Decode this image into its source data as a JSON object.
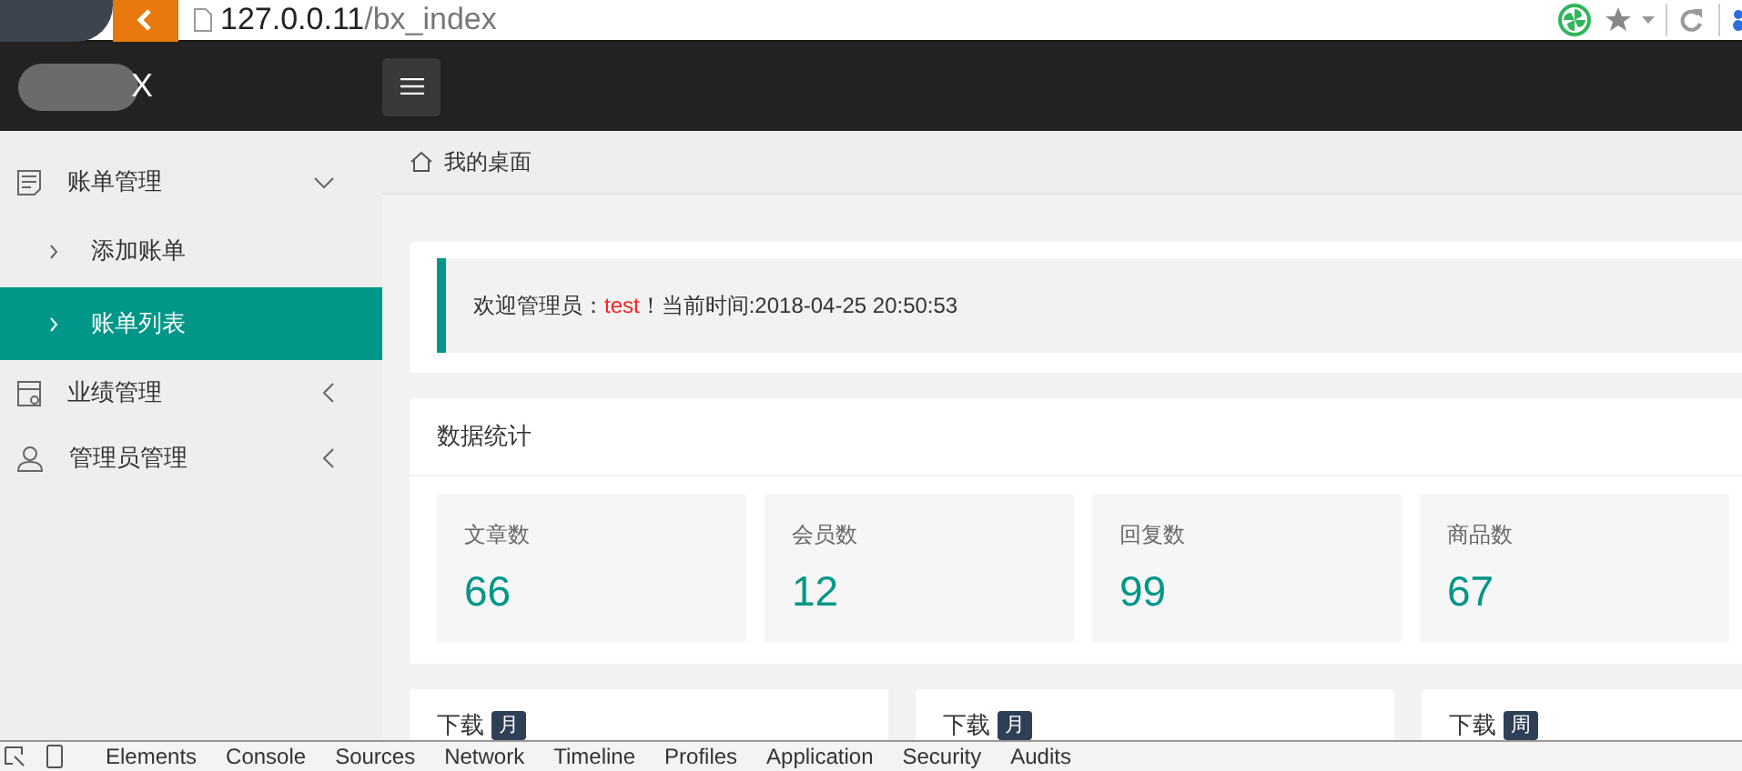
{
  "browser": {
    "url_host": "127.0.0.11",
    "url_path": "/bx_index"
  },
  "header": {
    "logo_tail": "X"
  },
  "sidebar": {
    "items": [
      {
        "label": "账单管理",
        "kind": "document",
        "expanded": true,
        "children": [
          {
            "label": "添加账单",
            "selected": false
          },
          {
            "label": "账单列表",
            "selected": true
          }
        ]
      },
      {
        "label": "业绩管理",
        "kind": "card",
        "expanded": false
      },
      {
        "label": "管理员管理",
        "kind": "user",
        "expanded": false
      }
    ]
  },
  "breadcrumb": "我的桌面",
  "welcome": {
    "prefix": "欢迎管理员：",
    "user": "test",
    "suffix": "！当前时间:2018-04-25 20:50:53"
  },
  "stats": {
    "title": "数据统计",
    "items": [
      {
        "label": "文章数",
        "value": "66"
      },
      {
        "label": "会员数",
        "value": "12"
      },
      {
        "label": "回复数",
        "value": "99"
      },
      {
        "label": "商品数",
        "value": "67"
      }
    ]
  },
  "downloads": [
    {
      "title": "下载",
      "badge": "月"
    },
    {
      "title": "下载",
      "badge": "月"
    },
    {
      "title": "下载",
      "badge": "周"
    }
  ],
  "devtools_tabs": [
    "Elements",
    "Console",
    "Sources",
    "Network",
    "Timeline",
    "Profiles",
    "Application",
    "Security",
    "Audits"
  ]
}
